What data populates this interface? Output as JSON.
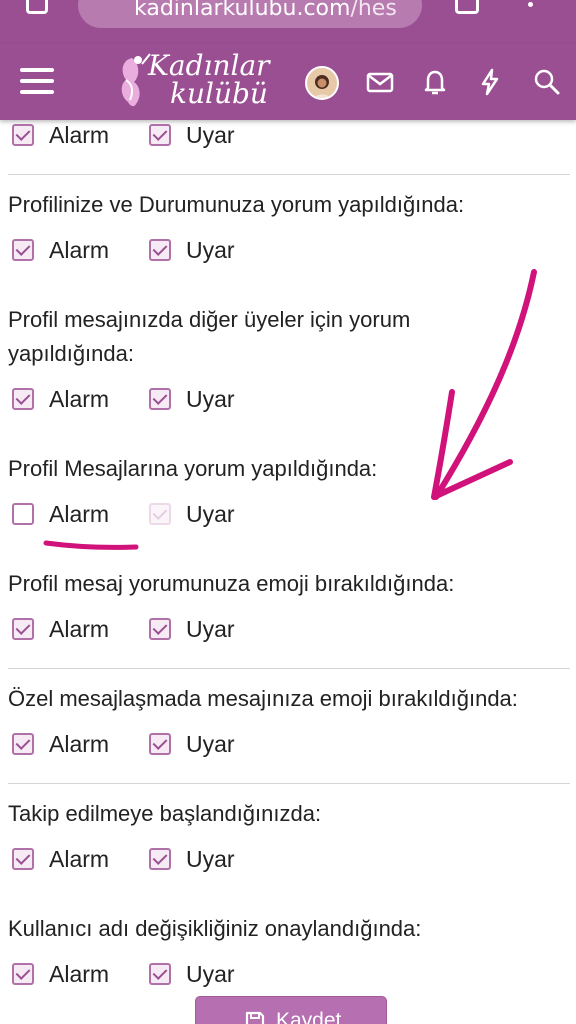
{
  "browser": {
    "url_host": "kadinlarkulubu.com",
    "url_path": "/hes"
  },
  "header": {
    "logo_line1": "Kadınlar",
    "logo_line2": "kulübü"
  },
  "labels": {
    "alarm": "Alarm",
    "warn": "Uyar"
  },
  "preferences": [
    {
      "question": "",
      "alarm": true,
      "warn": true
    },
    {
      "question": "Profilinize ve Durumunuza yorum yapıldığında:",
      "alarm": true,
      "warn": true
    },
    {
      "question": "Profil mesajınızda diğer üyeler için yorum yapıldığında:",
      "alarm": true,
      "warn": true
    },
    {
      "question": "Profil Mesajlarına yorum yapıldığında:",
      "alarm": false,
      "warn": true
    },
    {
      "question": "Profil mesaj yorumunuza emoji bırakıldığında:",
      "alarm": true,
      "warn": true
    },
    {
      "question": "Özel mesajlaşmada mesajınıza emoji bırakıldığında:",
      "alarm": true,
      "warn": true
    },
    {
      "question": "Takip edilmeye başlandığınızda:",
      "alarm": true,
      "warn": true
    },
    {
      "question": "Kullanıcı adı değişikliğiniz onaylandığında:",
      "alarm": true,
      "warn": true
    }
  ],
  "save_label": "Kaydet",
  "colors": {
    "brand": "#9b4f93",
    "checkbox_border": "#b070a8",
    "annotation": "#d0127a"
  }
}
